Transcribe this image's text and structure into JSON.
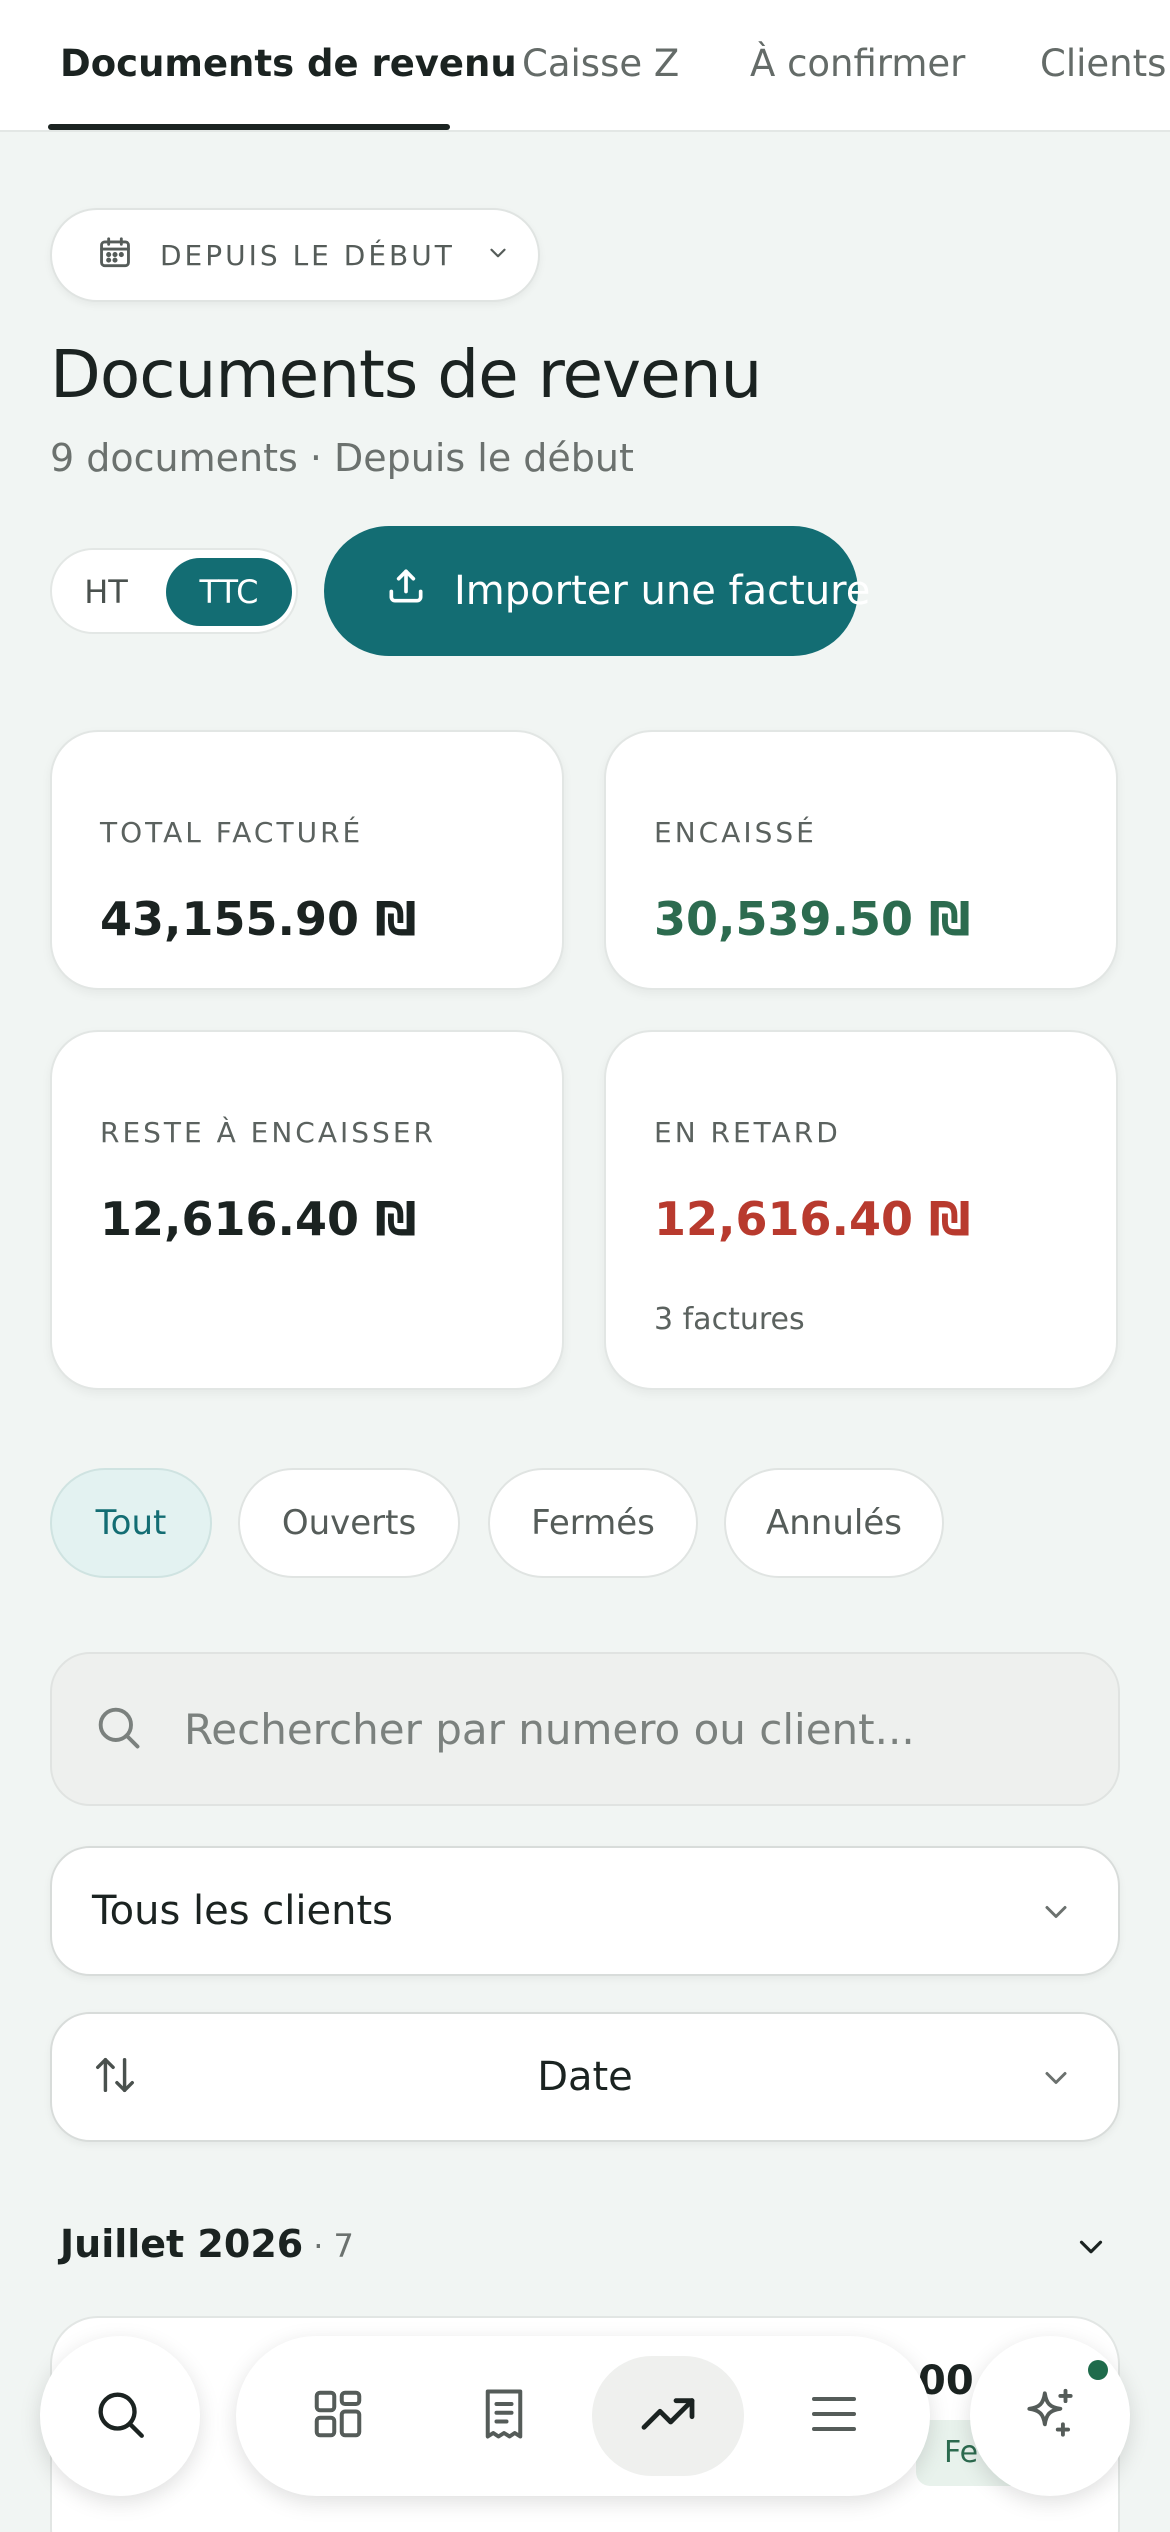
{
  "tabs": [
    {
      "label": "Documents de revenu",
      "active": true
    },
    {
      "label": "Caisse Z",
      "active": false
    },
    {
      "label": "À confirmer",
      "active": false
    },
    {
      "label": "Clients",
      "active": false
    }
  ],
  "date_filter": {
    "label": "DEPUIS LE DÉBUT",
    "icon": "calendar-icon"
  },
  "page": {
    "title": "Documents de revenu",
    "subtitle": "9 documents · Depuis le début"
  },
  "tax_toggle": {
    "ht": "HT",
    "ttc": "TTC",
    "selected": "TTC"
  },
  "import_button": {
    "label": "Importer une facture",
    "icon": "upload-icon"
  },
  "kpis": {
    "total": {
      "label": "TOTAL FACTURÉ",
      "value": "43,155.90 ₪"
    },
    "cashed": {
      "label": "ENCAISSÉ",
      "value": "30,539.50 ₪"
    },
    "remaining": {
      "label": "RESTE À ENCAISSER",
      "value": "12,616.40 ₪"
    },
    "late": {
      "label": "EN RETARD",
      "value": "12,616.40 ₪",
      "note": "3 factures"
    }
  },
  "status_filters": [
    {
      "label": "Tout",
      "active": true
    },
    {
      "label": "Ouverts",
      "active": false
    },
    {
      "label": "Fermés",
      "active": false
    },
    {
      "label": "Annulés",
      "active": false
    }
  ],
  "search": {
    "placeholder": "Rechercher par numero ou client...",
    "value": ""
  },
  "client_select": {
    "value": "Tous les clients"
  },
  "sort_select": {
    "value": "Date"
  },
  "group": {
    "month": "Juillet 2026",
    "count": "· 7"
  },
  "peek": {
    "amount": "00",
    "badge": "Fe"
  },
  "colors": {
    "accent": "#136d73",
    "positive": "#2c6b4f",
    "late": "#b83a2e",
    "background": "#f1f5f3"
  }
}
